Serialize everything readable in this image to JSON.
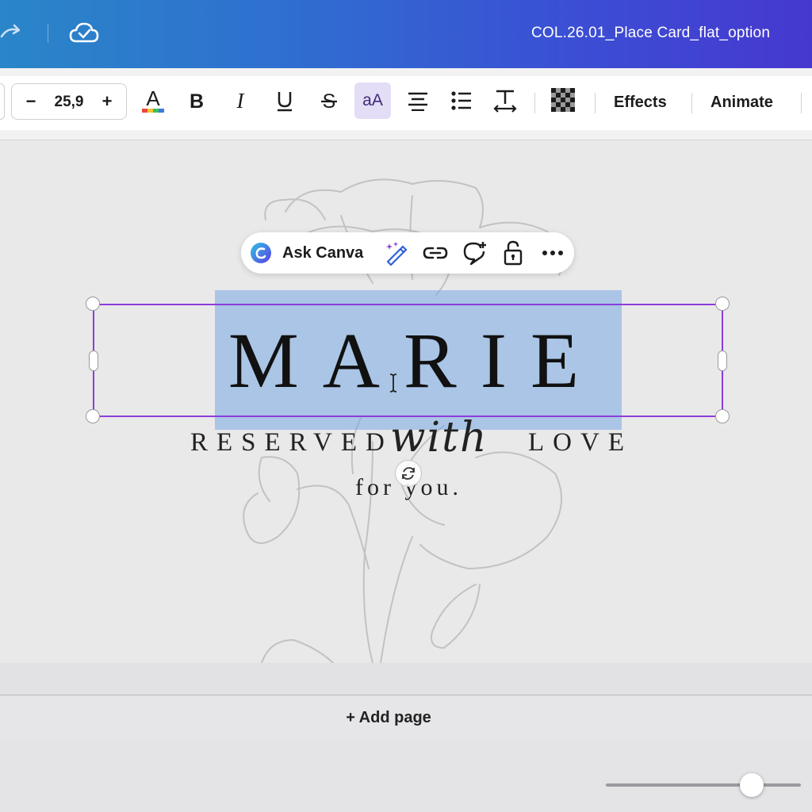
{
  "header": {
    "document_title": "COL.26.01_Place Card_flat_option",
    "icons": [
      "redo-icon",
      "cloud-saved-icon"
    ]
  },
  "toolbar": {
    "font_size_decrease": "−",
    "font_size_value": "25,9",
    "font_size_increase": "+",
    "effects_label": "Effects",
    "animate_label": "Animate",
    "case_toggle_label": "aA",
    "icons": [
      "text-color-icon",
      "bold-icon",
      "italic-icon",
      "underline-icon",
      "strikethrough-icon",
      "letter-case-icon",
      "align-center-icon",
      "bullet-list-icon",
      "spacing-icon",
      "transparency-icon"
    ]
  },
  "floating_toolbar": {
    "ask_canva_label": "Ask Canva",
    "icons": [
      "ask-canva-icon",
      "magic-write-icon",
      "link-icon",
      "add-comment-icon",
      "lock-icon",
      "more-icon"
    ]
  },
  "canvas": {
    "name_text": "MARIE",
    "reserved_text": "RESERVED",
    "with_text": "with",
    "love_text": "LOVE",
    "for_you_text": "for you."
  },
  "footer": {
    "add_page_label": "+ Add page"
  },
  "colors": {
    "header_gradient_start": "#2a86c8",
    "header_gradient_end": "#4638cf",
    "selection_border": "#8b3dda",
    "text_highlight": "#76a8e4",
    "active_button_bg": "#e4ddf6"
  }
}
